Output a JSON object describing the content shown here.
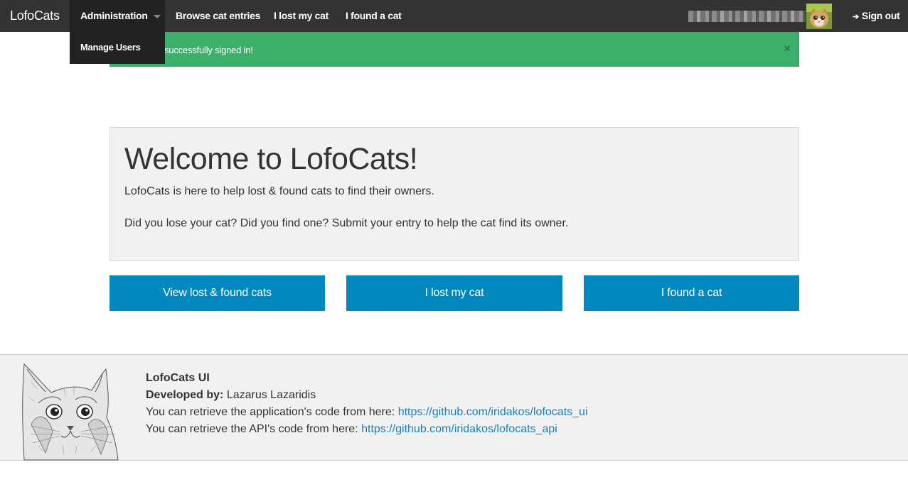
{
  "nav": {
    "brand": "LofoCats",
    "administration": "Administration",
    "browse": "Browse cat entries",
    "lost": "I lost my cat",
    "found": "I found a cat",
    "signout": "Sign out",
    "signout_icon": "sign-out-icon"
  },
  "dropdown": {
    "manage_users": "Manage Users"
  },
  "alert": {
    "message": "successfully signed in!",
    "close": "×"
  },
  "jumbotron": {
    "title": "Welcome to LofoCats!",
    "paragraph1": "LofoCats is here to help lost & found cats to find their owners.",
    "paragraph2": "Did you lose your cat? Did you find one? Submit your entry to help the cat find its owner."
  },
  "buttons": {
    "view": "View lost & found cats",
    "lost": "I lost my cat",
    "found": "I found a cat"
  },
  "footer": {
    "title": "LofoCats UI",
    "developed_label": "Developed by:",
    "developer": "Lazarus Lazaridis",
    "app_code_text": "You can retrieve the application's code from here:",
    "app_code_link": "https://github.com/iridakos/lofocats_ui",
    "api_code_text": "You can retrieve the API's code from here:",
    "api_code_link": "https://github.com/iridakos/lofocats_api"
  },
  "colors": {
    "navbar": "#333333",
    "alert_green": "#3cb06a",
    "button_blue": "#0088bf",
    "link_blue": "#1a7fb5"
  }
}
